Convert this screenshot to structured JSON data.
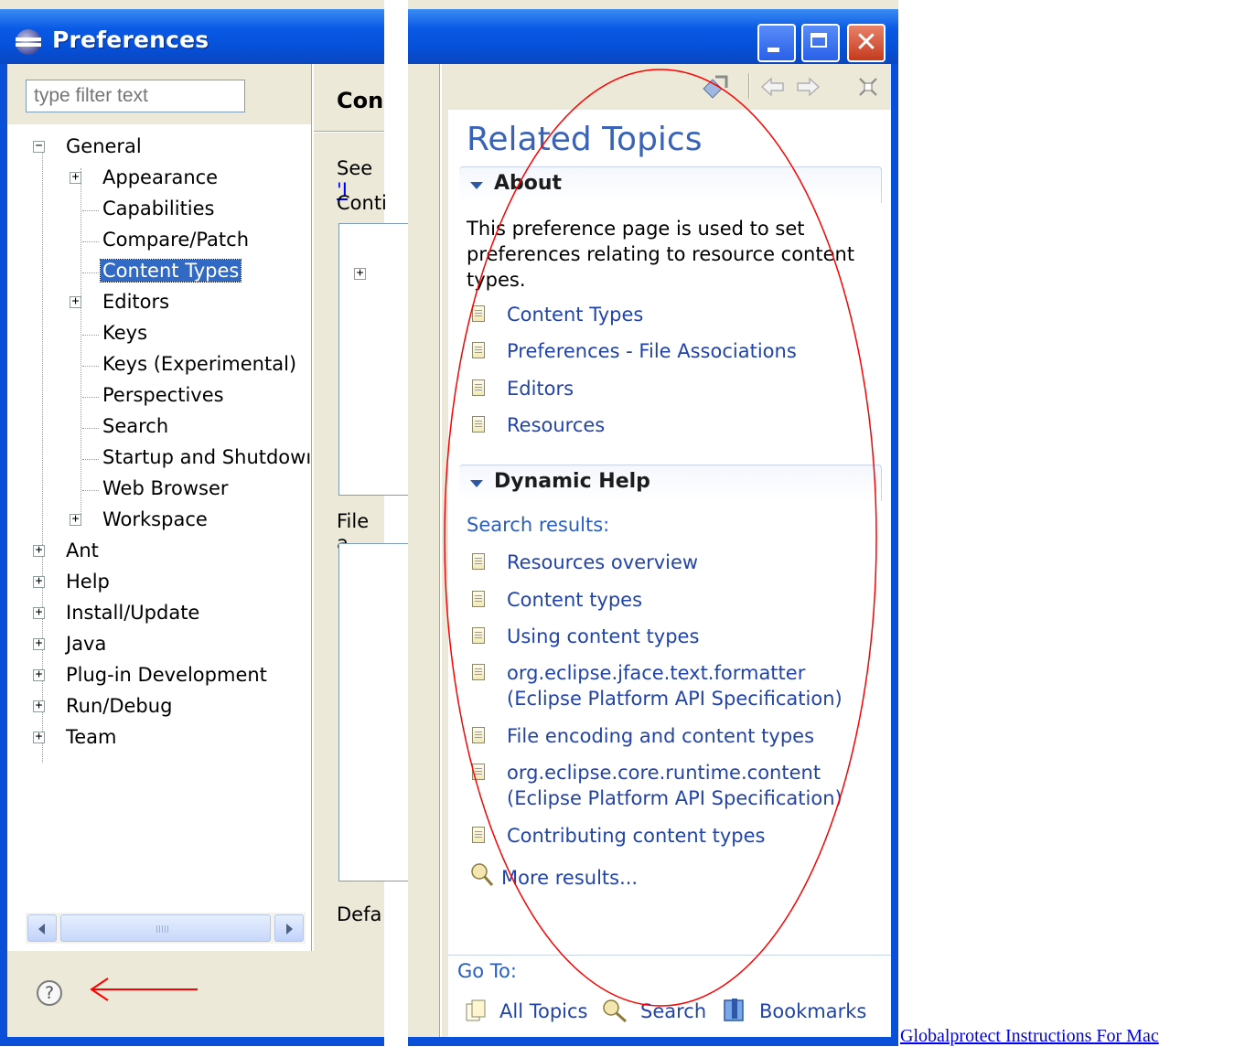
{
  "left_window": {
    "title": "Preferences",
    "filter_placeholder": "type filter text",
    "tree": [
      {
        "label": "General",
        "expanded": true
      },
      {
        "label": "Appearance"
      },
      {
        "label": "Capabilities"
      },
      {
        "label": "Compare/Patch"
      },
      {
        "label": "Content Types",
        "selected": true
      },
      {
        "label": "Editors"
      },
      {
        "label": "Keys"
      },
      {
        "label": "Keys (Experimental)"
      },
      {
        "label": "Perspectives"
      },
      {
        "label": "Search"
      },
      {
        "label": "Startup and Shutdowı"
      },
      {
        "label": "Web Browser"
      },
      {
        "label": "Workspace"
      },
      {
        "label": "Ant"
      },
      {
        "label": "Help"
      },
      {
        "label": "Install/Update"
      },
      {
        "label": "Java"
      },
      {
        "label": "Plug-in Development"
      },
      {
        "label": "Run/Debug"
      },
      {
        "label": "Team"
      }
    ],
    "expanders": {
      "collapsed": "+",
      "expanded": "−"
    },
    "page_title": "Con",
    "see_prefix": "See",
    "see_link": "'I",
    "content_types_label": "Conti",
    "file_assoc_label": "File a",
    "default_label": "Defa",
    "help_icon": "?"
  },
  "right_window": {
    "close_glyph": "✕",
    "toolbar_icons": [
      "link-with-editor-icon",
      "back-icon",
      "forward-icon",
      "close-icon"
    ],
    "heading": "Related Topics",
    "about": {
      "title": "About",
      "description": "This preference page is used to set preferences relating to resource content types.",
      "links": [
        "Content Types",
        "Preferences - File Associations",
        "Editors",
        "Resources"
      ]
    },
    "dynamic_help": {
      "title": "Dynamic Help",
      "search_results_label": "Search results:",
      "results": [
        {
          "line1": "Resources overview"
        },
        {
          "line1": "Content types"
        },
        {
          "line1": "Using content types"
        },
        {
          "line1": "org.eclipse.jface.text.formatter",
          "line2": "(Eclipse Platform API Specification)"
        },
        {
          "line1": "File encoding and content types"
        },
        {
          "line1": "org.eclipse.core.runtime.content",
          "line2": "(Eclipse Platform API Specification)"
        },
        {
          "line1": "Contributing content types"
        }
      ],
      "more_results": "More results..."
    },
    "goto": {
      "label": "Go To:",
      "all_topics": "All Topics",
      "search": "Search",
      "bookmarks": "Bookmarks"
    }
  },
  "caption": "Globalprotect Instructions For Mac",
  "colors": {
    "title_bar": "#0a5ae6",
    "link": "#2243a8",
    "heading": "#3a63b8",
    "selection": "#316ac5",
    "annotation": "#ff0000"
  }
}
